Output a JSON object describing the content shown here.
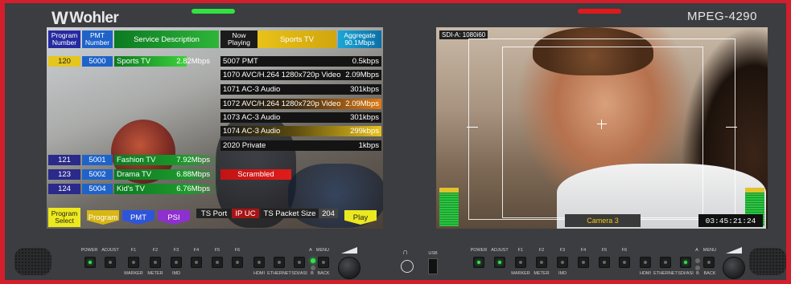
{
  "device": {
    "brand": "Wohler",
    "model": "MPEG-4290"
  },
  "colors": {
    "bezel": "#d21f2b",
    "panel": "#3b3d40",
    "led_left": "#31e241",
    "led_right": "#e2191c"
  },
  "left_screen": {
    "header": {
      "program_number": "Program\nNumber",
      "pmt_number": "PMT\nNumber",
      "service_description": "Service Description",
      "now_playing": "Now\nPlaying",
      "now_playing_value": "Sports TV",
      "aggregate": "Aggregate\n90.1Mbps"
    },
    "programs": [
      {
        "program": "120",
        "pmt": "5000",
        "name": "Sports TV",
        "rate": "2.82Mbps"
      },
      {
        "program": "121",
        "pmt": "5001",
        "name": "Fashion TV",
        "rate": "7.92Mbps"
      },
      {
        "program": "123",
        "pmt": "5002",
        "name": "Drama TV",
        "rate": "6.88Mbps"
      },
      {
        "program": "124",
        "pmt": "5004",
        "name": "Kid's TV",
        "rate": "6.76Mbps"
      }
    ],
    "streams": [
      {
        "name": "5007 PMT",
        "rate": "0.5kbps"
      },
      {
        "name": "1070 AVC/H.264 1280x720p Video",
        "rate": "2.09Mbps"
      },
      {
        "name": "1071 AC-3 Audio",
        "rate": "301kbps"
      },
      {
        "name": "1072 AVC/H.264 1280x720p Video",
        "rate": "2.09Mbps"
      },
      {
        "name": "1073 AC-3 Audio",
        "rate": "301kbps"
      },
      {
        "name": "1074 AC-3 Audio",
        "rate": "299kbps"
      },
      {
        "name": "2020 Private",
        "rate": "1kbps"
      }
    ],
    "scrambled": "Scrambled",
    "bottom": {
      "program_select": "Program\nSelect",
      "program": "Program",
      "pmt": "PMT",
      "psi": "PSI",
      "ts_port": "TS Port",
      "ip_uc": "IP UC",
      "ts_packet_size": "TS Packet Size",
      "packet_size_value": "204",
      "play": "Play"
    }
  },
  "right_screen": {
    "input": "SDI-A: 1080i60",
    "camera_label": "Camera 3",
    "timecode": "03:45:21:24"
  },
  "controls": {
    "labels_top": [
      "POWER",
      "ADJUST",
      "F1",
      "F2",
      "F3",
      "F4",
      "F5",
      "F6",
      "A",
      "MENU"
    ],
    "labels_bottom": [
      "MARKER",
      "METER",
      "IMD",
      "HDMI",
      "ETHERNET",
      "SDI/ASI",
      "B",
      "BACK"
    ],
    "usb": "USB"
  }
}
